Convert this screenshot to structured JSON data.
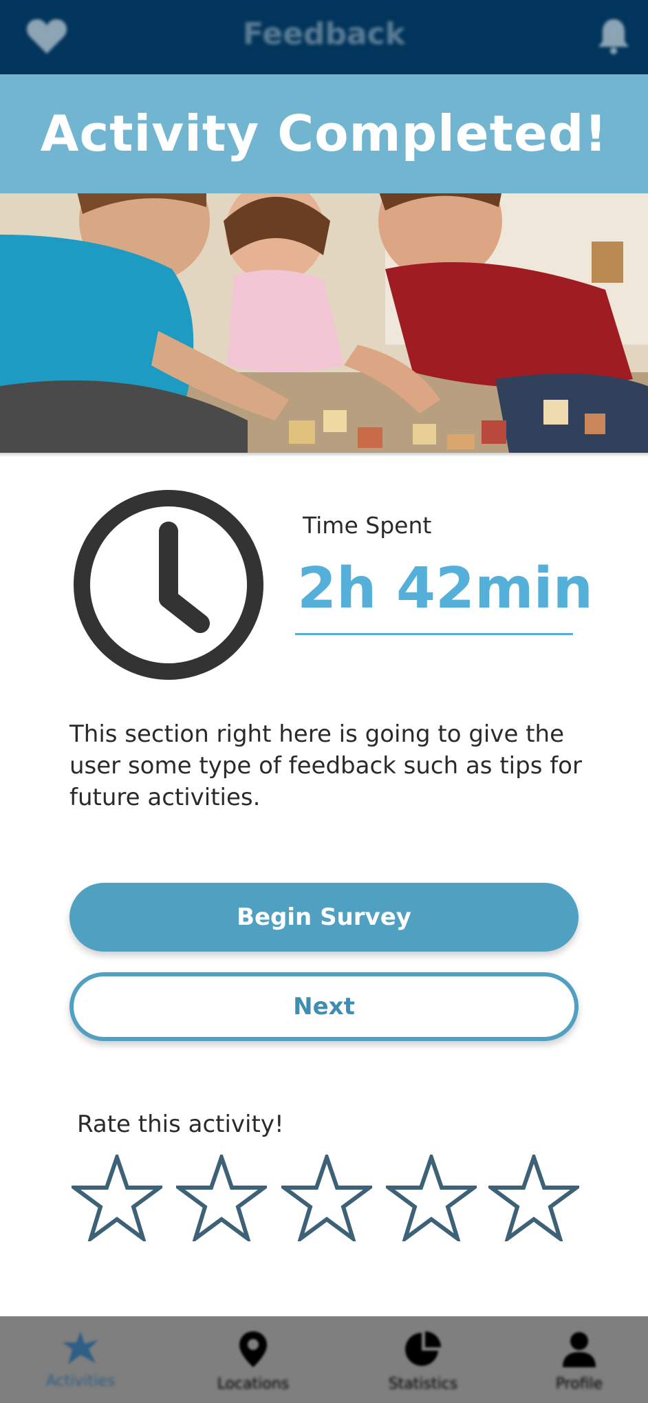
{
  "header": {
    "title": "Feedback"
  },
  "hero": {
    "banner_text": "Activity Completed!"
  },
  "stats": {
    "time_label": "Time Spent",
    "time_value": "2h 42min"
  },
  "feedback_text": "This section right here is going to give the user some type of feedback such as tips for future activities.",
  "buttons": {
    "begin_survey": "Begin Survey",
    "next": "Next"
  },
  "rating": {
    "label": "Rate this activity!",
    "max_stars": 5,
    "selected": 0
  },
  "bottom_nav": {
    "items": [
      {
        "label": "Activities",
        "icon": "activities-icon",
        "active": true
      },
      {
        "label": "Locations",
        "icon": "location-pin-icon",
        "active": false
      },
      {
        "label": "Statistics",
        "icon": "statistics-icon",
        "active": false
      },
      {
        "label": "Profile",
        "icon": "profile-icon",
        "active": false
      }
    ]
  },
  "colors": {
    "header_bg": "#02355c",
    "accent": "#55b0d9",
    "button": "#4fa0c1",
    "star_outline": "#3d6277",
    "nav_bg": "#7f7f7f",
    "nav_active": "#2f5f86"
  }
}
